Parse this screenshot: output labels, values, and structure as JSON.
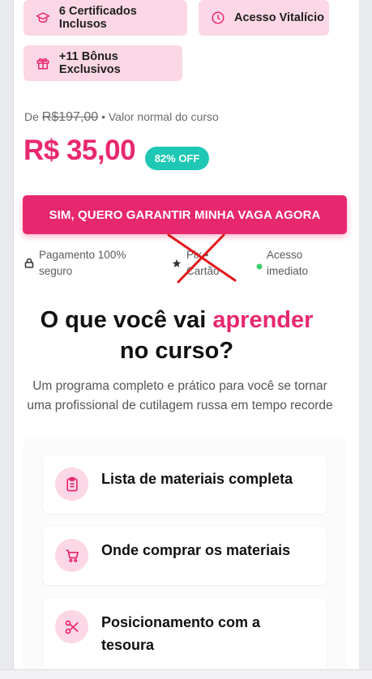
{
  "chips": [
    {
      "label": "6 Certificados Inclusos",
      "icon": "graduation-cap-icon"
    },
    {
      "label": "Acesso Vitalício",
      "icon": "clock-icon"
    },
    {
      "label": "+11 Bônus Exclusivos",
      "icon": "gift-icon"
    }
  ],
  "pricing": {
    "old_prefix": "De",
    "old_price": "R$197,00",
    "old_suffix": "• Valor normal do curso",
    "new_price": "R$ 35,00",
    "discount_badge": "82% OFF"
  },
  "cta": {
    "label": "SIM, QUERO GARANTIR MINHA VAGA AGORA"
  },
  "trust": {
    "secure_line1": "Pagamento 100%",
    "secure_line2": "seguro",
    "payment_line1": "Pix •",
    "payment_line2": "Cartão",
    "access_line1": "Acesso",
    "access_line2": "imediato"
  },
  "section": {
    "title_pre": "O que você vai ",
    "title_accent": "aprender",
    "title_post": "no curso?",
    "subtitle_line1": "Um programa completo e prático para você se tornar",
    "subtitle_line2": "uma profissional de cutilagem russa em tempo recorde"
  },
  "modules": [
    {
      "title": "Lista de materiais completa",
      "icon": "clipboard-icon"
    },
    {
      "title": "Onde comprar os materiais",
      "icon": "cart-icon"
    },
    {
      "title_line1": "Posicionamento com a",
      "title_line2": "tesoura",
      "icon": "scissors-icon"
    }
  ],
  "colors": {
    "accent": "#e8286e",
    "chip_bg": "#fcd7e5",
    "badge": "#1ec8b4",
    "online_dot": "#3ccf6e"
  }
}
